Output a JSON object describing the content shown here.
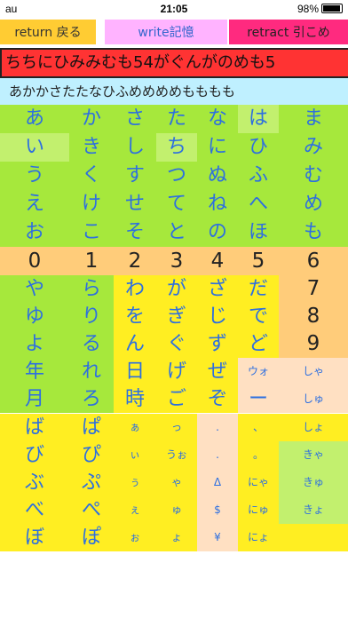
{
  "status": {
    "carrier": "au",
    "time": "21:05",
    "battery": "98%"
  },
  "buttons": {
    "return": "return 戻る",
    "write": "write記憶",
    "retract": "retract 引こめ"
  },
  "input_text": "ちちにひみみむも54がぐんがのめも5",
  "output_text": "あかかさたたなひふめめめめもももも",
  "columns": [
    {
      "kana": [
        "あ",
        "い",
        "う",
        "え",
        "お"
      ],
      "num": "0",
      "lower": [
        "や",
        "ゆ",
        "よ",
        "年",
        "月"
      ],
      "bottom": [
        "ば",
        "び",
        "ぶ",
        "べ",
        "ぼ"
      ]
    },
    {
      "kana": [
        "か",
        "き",
        "く",
        "け",
        "こ"
      ],
      "num": "1",
      "lower": [
        "ら",
        "り",
        "る",
        "れ",
        "ろ"
      ],
      "bottom": [
        "ぱ",
        "ぴ",
        "ぷ",
        "ぺ",
        "ぽ"
      ]
    },
    {
      "kana": [
        "さ",
        "し",
        "す",
        "せ",
        "そ"
      ],
      "num": "2",
      "lower": [
        "わ",
        "を",
        "ん",
        "日",
        "時"
      ],
      "bottom": [
        "ぁ",
        "ぃ",
        "ぅ",
        "ぇ",
        "ぉ"
      ]
    },
    {
      "kana": [
        "た",
        "ち",
        "つ",
        "て",
        "と"
      ],
      "num": "3",
      "lower": [
        "が",
        "ぎ",
        "ぐ",
        "げ",
        "ご"
      ],
      "bottom": [
        "っ",
        "うぉ",
        "ゃ",
        "ゅ",
        "ょ"
      ]
    },
    {
      "kana": [
        "な",
        "に",
        "ぬ",
        "ね",
        "の"
      ],
      "num": "4",
      "lower": [
        "ざ",
        "じ",
        "ず",
        "ぜ",
        "ぞ"
      ],
      "bottom": [
        ".",
        ".",
        "Δ",
        "$",
        "¥"
      ]
    },
    {
      "kana": [
        "は",
        "ひ",
        "ふ",
        "へ",
        "ほ"
      ],
      "num": "5",
      "lower": [
        "だ",
        "で",
        "ど",
        "ウォ",
        "ー"
      ],
      "bottom": [
        "、",
        "。",
        "にゃ",
        "にゅ",
        "にょ"
      ]
    },
    {
      "kana": [
        "ま",
        "み",
        "む",
        "め",
        "も"
      ],
      "num": "6",
      "lower": [
        "7",
        "8",
        "9",
        "しゃ",
        "しゅ"
      ],
      "bottom": [
        "しょ",
        "きゃ",
        "きゅ",
        "きょ",
        ""
      ]
    }
  ]
}
